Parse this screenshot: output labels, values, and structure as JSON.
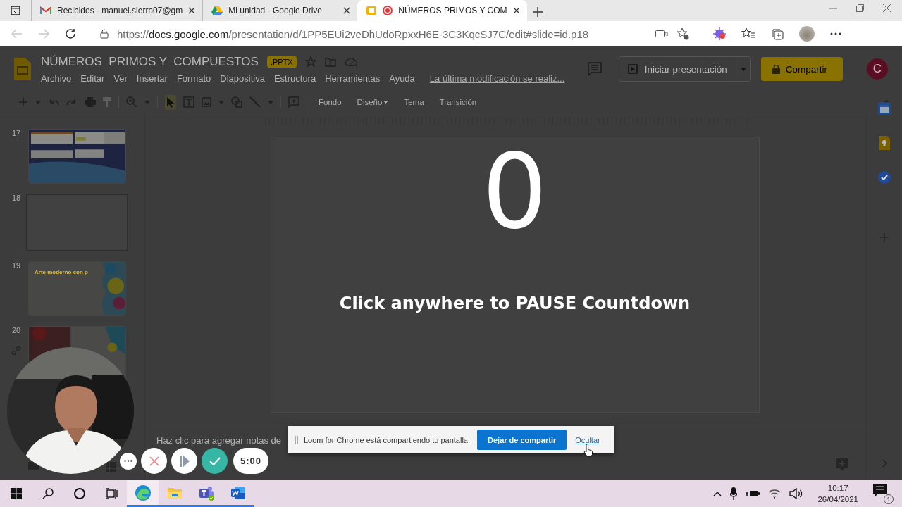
{
  "browser": {
    "tabs": [
      {
        "title": "Recibidos - manuel.sierra07@gm",
        "kind": "gmail",
        "recording": false,
        "selected": false
      },
      {
        "title": "Mi unidad - Google Drive",
        "kind": "drive",
        "recording": false,
        "selected": false
      },
      {
        "title": "NÚMEROS PRIMOS Y COM",
        "kind": "slides",
        "recording": true,
        "selected": true
      }
    ],
    "url": {
      "scheme": "https://",
      "host": "docs.google.com",
      "path": "/presentation/d/1PP5EUi2veDhUdoRpxxH6E-3C3KqcSJ7C/edit#slide=id.p18"
    }
  },
  "docs": {
    "title": "NÚMEROS  PRIMOS Y  COMPUESTOS",
    "badge": ".PPTX",
    "menu": [
      "Archivo",
      "Editar",
      "Ver",
      "Insertar",
      "Formato",
      "Diapositiva",
      "Estructura",
      "Herramientas",
      "Ayuda"
    ],
    "last_edit": "La última modificación se realiz...",
    "present": "Iniciar presentación",
    "share": "Compartir",
    "avatar": "C",
    "toolbar_buttons": [
      {
        "label": "Fondo",
        "dropdown": false
      },
      {
        "label": "Diseño",
        "dropdown": true
      },
      {
        "label": "Tema",
        "dropdown": false
      },
      {
        "label": "Transición",
        "dropdown": false
      }
    ]
  },
  "filmstrip": [
    {
      "number": "17",
      "kind": "panels",
      "selected": false
    },
    {
      "number": "18",
      "kind": "blank",
      "selected": true
    },
    {
      "number": "19",
      "kind": "splash",
      "title": "Arte moderno con p",
      "selected": false
    },
    {
      "number": "20",
      "kind": "splash-dark",
      "selected": false
    }
  ],
  "slide": {
    "countdown": "0",
    "message": "Click anywhere to PAUSE Countdown"
  },
  "notes": {
    "placeholder": "Haz clic para agregar notas de"
  },
  "loom": {
    "message": "Loom for Chrome está compartiendo tu pantalla.",
    "stop": "Dejar de compartir",
    "hide": "Ocultar"
  },
  "recorder": {
    "timer": "5:00"
  },
  "taskbar": {
    "apps": [
      {
        "kind": "edge",
        "selected": true
      },
      {
        "kind": "explorer",
        "selected": false
      },
      {
        "kind": "teams",
        "selected": false
      },
      {
        "kind": "word",
        "selected": false
      }
    ],
    "time": "10:17",
    "date": "26/04/2021",
    "notifications": "1"
  }
}
